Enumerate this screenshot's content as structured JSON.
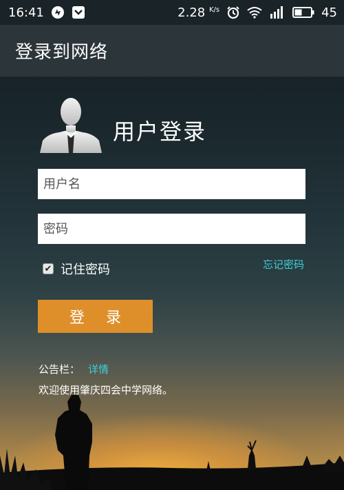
{
  "status_bar": {
    "time": "16:41",
    "network_speed": "2.28",
    "speed_unit": "K/s",
    "battery": "45",
    "icons": [
      "notification-app-icon",
      "notification-download-icon",
      "alarm-icon",
      "wifi-icon",
      "signal-3g-icon",
      "battery-icon"
    ]
  },
  "app_bar": {
    "title": "登录到网络"
  },
  "login": {
    "heading": "用户登录",
    "username_placeholder": "用户名",
    "password_placeholder": "密码",
    "remember_label": "记住密码",
    "remember_checked": true,
    "forgot_label": "忘记密码",
    "submit_label": "登 录"
  },
  "notice": {
    "label": "公告栏：",
    "link_label": "详情",
    "text": "欢迎使用肇庆四会中学网络。"
  },
  "colors": {
    "accent_orange": "#df8f2a",
    "link_cyan": "#3fd0d8",
    "app_bar": "#2c3539"
  }
}
